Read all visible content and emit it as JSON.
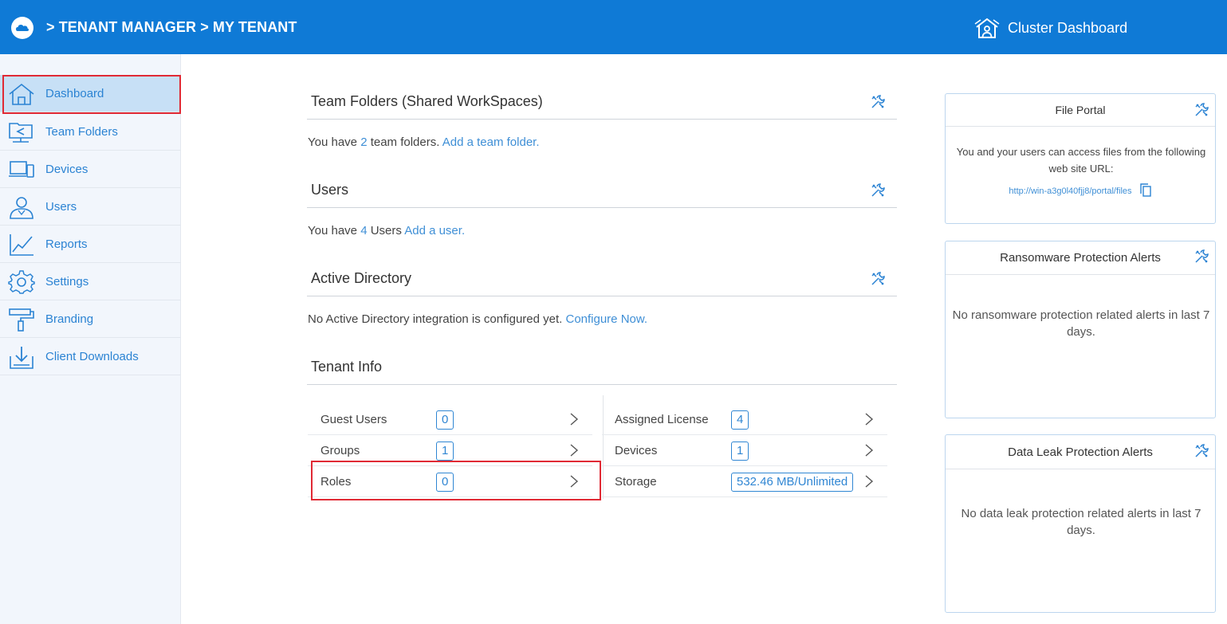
{
  "header": {
    "breadcrumb": "> TENANT MANAGER > MY TENANT",
    "cluster_label": "Cluster Dashboard",
    "bg_color": "#0f7ad6"
  },
  "sidebar": {
    "items": [
      {
        "label": "Dashboard",
        "icon": "home-icon",
        "active": true
      },
      {
        "label": "Team Folders",
        "icon": "team-folders-icon"
      },
      {
        "label": "Devices",
        "icon": "devices-icon"
      },
      {
        "label": "Users",
        "icon": "user-icon"
      },
      {
        "label": "Reports",
        "icon": "chart-icon"
      },
      {
        "label": "Settings",
        "icon": "gear-icon"
      },
      {
        "label": "Branding",
        "icon": "paint-roller-icon"
      },
      {
        "label": "Client Downloads",
        "icon": "download-icon"
      }
    ]
  },
  "team_folders": {
    "title": "Team Folders (Shared WorkSpaces)",
    "text_prefix": "You have ",
    "count": "2",
    "text_suffix": " team folders. ",
    "link": "Add a team folder."
  },
  "users": {
    "title": "Users",
    "text_prefix": "You have ",
    "count": "4",
    "text_suffix": " Users ",
    "link": "Add a user."
  },
  "active_directory": {
    "title": "Active Directory",
    "text": "No Active Directory integration is configured yet. ",
    "link": "Configure Now."
  },
  "tenant_info": {
    "title": "Tenant Info",
    "left": [
      {
        "label": "Guest Users",
        "value": "0"
      },
      {
        "label": "Groups",
        "value": "1"
      },
      {
        "label": "Roles",
        "value": "0"
      }
    ],
    "right": [
      {
        "label": "Assigned License",
        "value": "4"
      },
      {
        "label": "Devices",
        "value": "1"
      },
      {
        "label": "Storage",
        "value": "532.46 MB/Unlimited"
      }
    ]
  },
  "file_portal": {
    "title": "File Portal",
    "text": "You and your users can access files from the following web site URL:",
    "url": "http://win-a3g0l40fjj8/portal/files"
  },
  "ransomware": {
    "title": "Ransomware Protection Alerts",
    "text": "No ransomware protection related alerts in last 7 days."
  },
  "data_leak": {
    "title": "Data Leak Protection Alerts",
    "text": "No data leak protection related alerts in last 7 days."
  }
}
